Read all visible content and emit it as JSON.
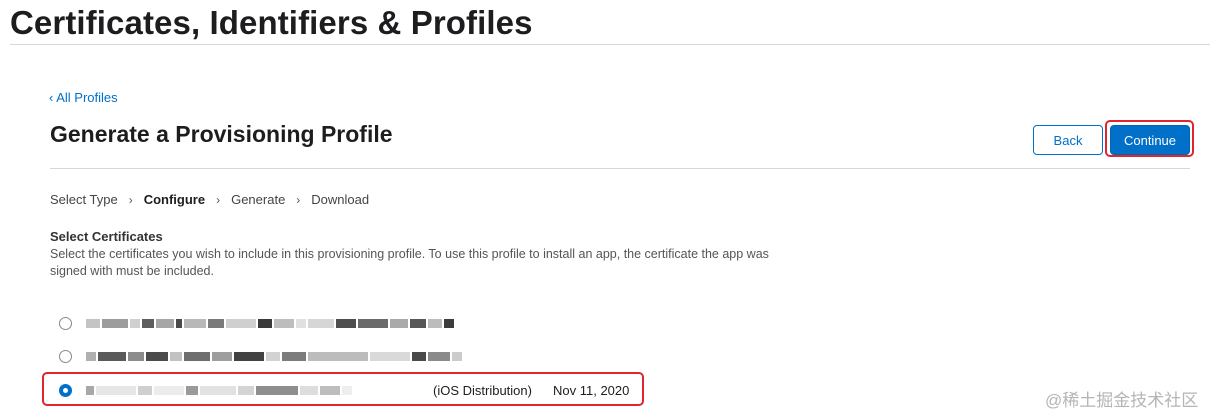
{
  "page": {
    "title": "Certificates, Identifiers & Profiles"
  },
  "nav": {
    "back_link": "‹ All Profiles"
  },
  "section": {
    "title": "Generate a Provisioning Profile"
  },
  "buttons": {
    "back": "Back",
    "continue": "Continue"
  },
  "steps": [
    {
      "label": "Select Type",
      "active": false
    },
    {
      "label": "Configure",
      "active": true
    },
    {
      "label": "Generate",
      "active": false
    },
    {
      "label": "Download",
      "active": false
    }
  ],
  "certificates": {
    "heading": "Select Certificates",
    "description": "Select the certificates you wish to include in this provisioning profile. To use this profile to install an app, the certificate the app was signed with must be included.",
    "items": [
      {
        "name": "",
        "type": "",
        "date": "",
        "selected": false
      },
      {
        "name": "",
        "type": "",
        "date": "",
        "selected": false
      },
      {
        "name": "",
        "type": "(iOS Distribution)",
        "date": "Nov 11, 2020",
        "selected": true
      }
    ]
  },
  "watermark": "@稀土掘金技术社区",
  "colors": {
    "accent": "#0070c9",
    "highlight": "#e0252f"
  }
}
